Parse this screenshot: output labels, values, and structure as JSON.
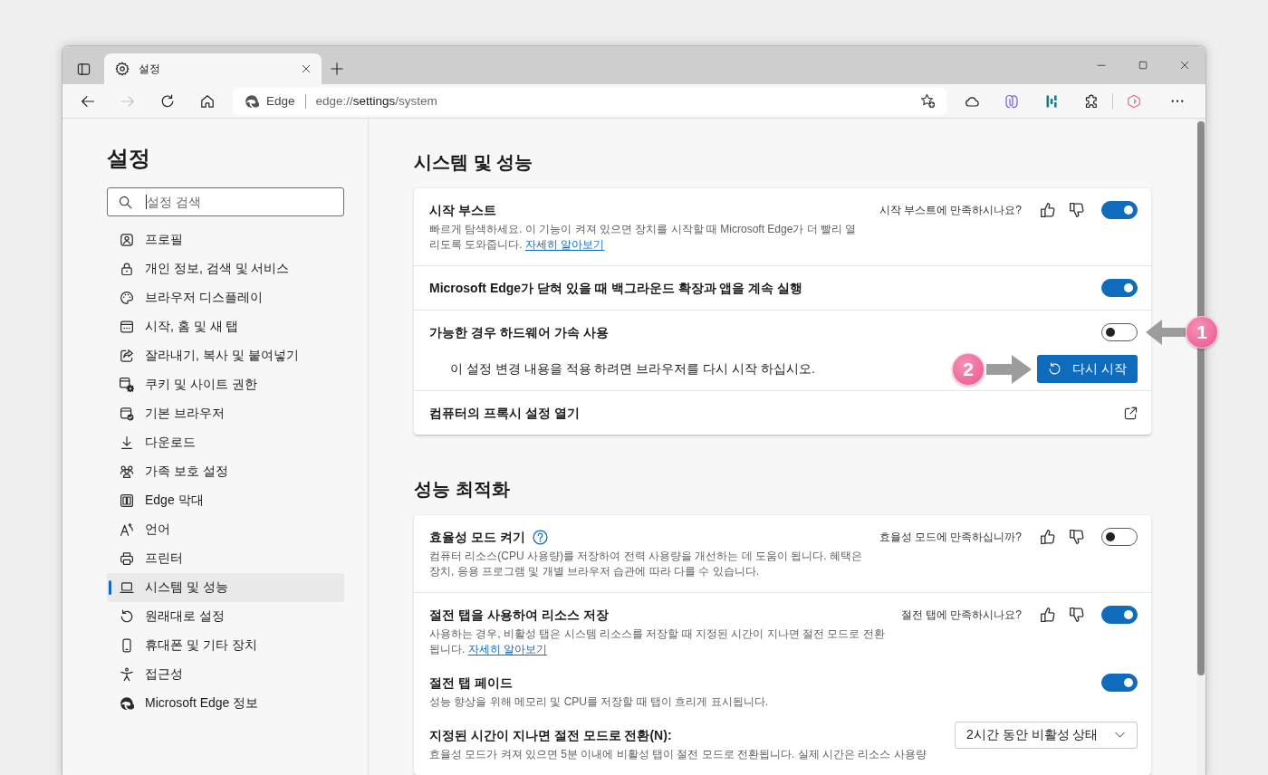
{
  "browser": {
    "tabs": [
      {
        "label": "설정",
        "selected": true
      }
    ],
    "forward_disabled": true,
    "address": {
      "site_label": "Edge",
      "url": "edge://**settings**/system"
    }
  },
  "sidebar": {
    "title": "설정",
    "search": {
      "placeholder": "설정 검색",
      "focused": true
    },
    "items": [
      {
        "label": "프로필",
        "selected": false
      },
      {
        "label": "개인 정보, 검색 및 서비스",
        "selected": false
      },
      {
        "label": "브라우저 디스플레이",
        "selected": false
      },
      {
        "label": "시작, 홈 및 새 탭",
        "selected": false
      },
      {
        "label": "잘라내기, 복사 및 붙여넣기",
        "selected": false
      },
      {
        "label": "쿠키 및 사이트 권한",
        "selected": false
      },
      {
        "label": "기본 브라우저",
        "selected": false
      },
      {
        "label": "다운로드",
        "selected": false
      },
      {
        "label": "가족 보호 설정",
        "selected": false
      },
      {
        "label": "Edge 막대",
        "selected": false
      },
      {
        "label": "언어",
        "selected": false
      },
      {
        "label": "프린터",
        "selected": false
      },
      {
        "label": "시스템 및 성능",
        "selected": true
      },
      {
        "label": "원래대로 설정",
        "selected": false
      },
      {
        "label": "휴대폰 및 기타 장치",
        "selected": false
      },
      {
        "label": "접근성",
        "selected": false
      },
      {
        "label": "Microsoft Edge 정보",
        "selected": false
      }
    ]
  },
  "main": {
    "sections": [
      {
        "title": "시스템 및 성능",
        "groups": [
          {
            "rows": [
              {
                "kind": "toggle",
                "title": "시작 부스트",
                "description": "빠르게 탐색하세요. 이 기능이 켜져 있으면 장치를 시작할 때 Microsoft Edge가 더 빨리 열리도록 도와줍니다.",
                "link": "자세히 알아보기",
                "feedback": "시작 부스트에 만족하시나요?",
                "on": true
              }
            ]
          },
          {
            "rows": [
              {
                "kind": "toggle",
                "title": "Microsoft Edge가 닫혀 있을 때 백그라운드 확장과 앱을 계속 실행",
                "on": true
              }
            ]
          },
          {
            "rows": [
              {
                "kind": "toggle",
                "title": "가능한 경우 하드웨어 가속 사용",
                "on": false,
                "toggle_callout": "1",
                "notice": "이 설정 변경 내용을 적용 하려면 브라우저를 다시 시작 하십시오.",
                "button": "다시 시작",
                "button_callout": "2"
              }
            ]
          },
          {
            "rows": [
              {
                "kind": "link",
                "title": "컴퓨터의 프록시 설정 열기"
              }
            ]
          }
        ]
      },
      {
        "title": "성능 최적화",
        "groups": [
          {
            "rows": [
              {
                "kind": "toggle",
                "title": "효율성 모드 켜기",
                "help": true,
                "description": "컴퓨터 리소스(CPU 사용량)를 저장하여 전력 사용량을 개선하는 데 도움이 됩니다. 혜택은 장치, 응용 프로그램 및 개별 브라우저 습관에 따라 다를 수 있습니다.",
                "feedback": "효율성 모드에 만족하십니까?",
                "on": false
              }
            ]
          },
          {
            "rows": [
              {
                "kind": "toggle",
                "title": "절전 탭을 사용하여 리소스 저장",
                "description": "사용하는 경우, 비활성 탭은 시스템 리소스를 저장할 때 지정된 시간이 지나면 절전 모드로 전환됩니다.",
                "link": "자세히 알아보기",
                "feedback": "절전 탭에 만족하시나요?",
                "on": true
              },
              {
                "kind": "toggle",
                "title": "절전 탭 페이드",
                "description": "성능 향상을 위해 메모리 및 CPU를 저장할 때 탭이 흐리게 표시됩니다.",
                "on": true
              },
              {
                "kind": "dropdown",
                "title": "지정된 시간이 지나면 절전 모드로 전환(N):",
                "value": "2시간 동안 비활성 상태",
                "description": "효율성 모드가 켜져 있으면 5분 이내에 비활성 탭이 절전 모드로 전환됩니다. 실제 시간은 리소스 사용량"
              }
            ]
          }
        ]
      }
    ]
  }
}
